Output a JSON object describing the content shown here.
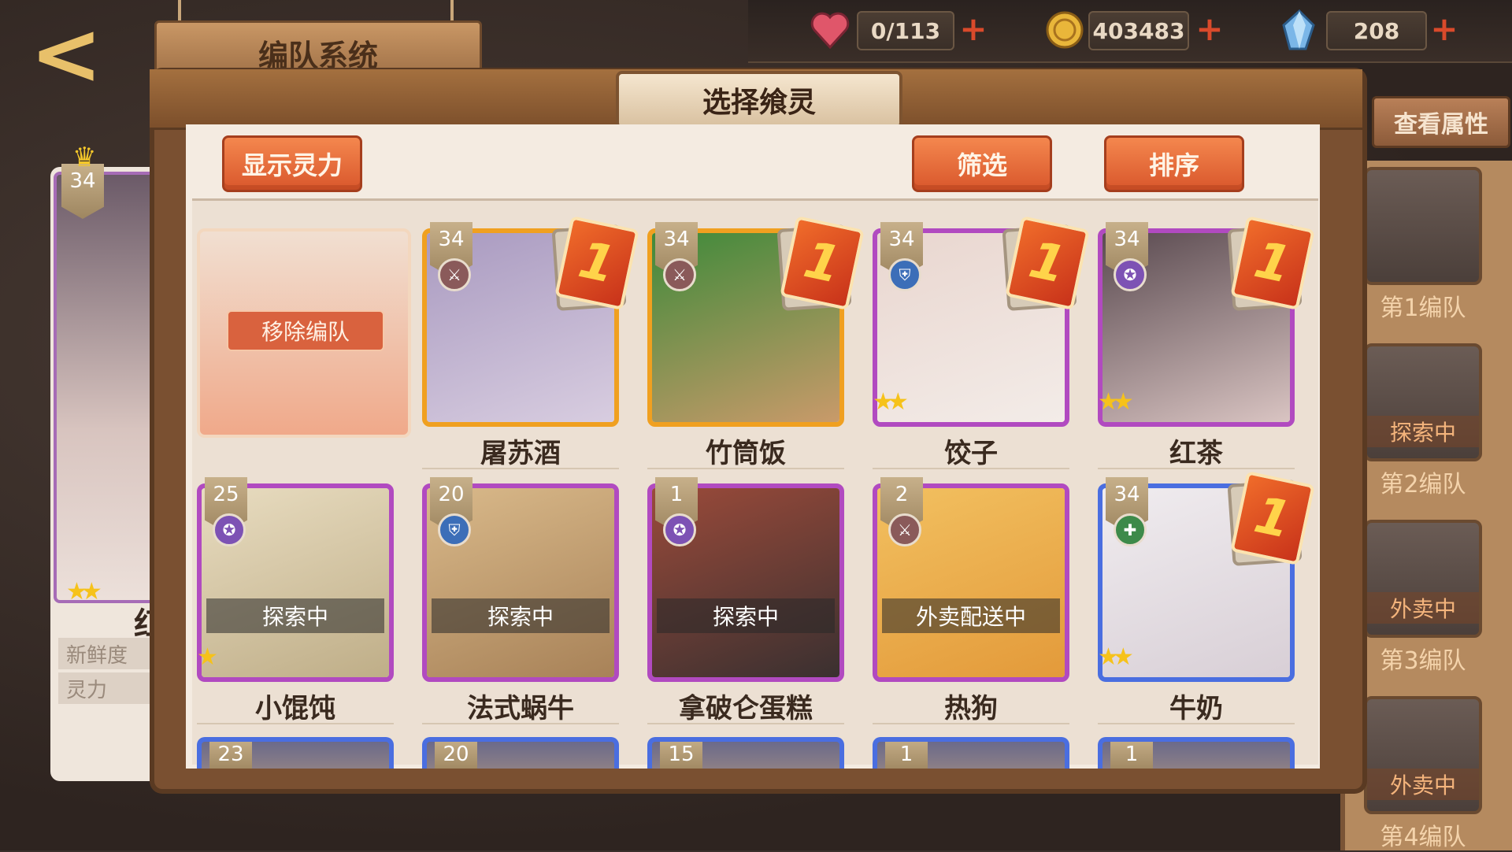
{
  "resources": {
    "stamina": "0/113",
    "coins": "403483",
    "gems": "208",
    "plus_label": "+"
  },
  "header": {
    "back_glyph": "<",
    "title": "编队系统"
  },
  "left_panel": {
    "level": "34",
    "name": "红茶",
    "freshness_label": "新鲜度",
    "power_label": "灵力"
  },
  "right_panel": {
    "view_attributes": "查看属性",
    "teams": [
      {
        "label": "第1编队",
        "status": ""
      },
      {
        "label": "第2编队",
        "status": "探索中"
      },
      {
        "label": "第3编队",
        "status": "外卖中"
      },
      {
        "label": "第4编队",
        "status": "外卖中"
      }
    ]
  },
  "modal": {
    "title": "选择飨灵",
    "show_power": "显示灵力",
    "filter": "筛选",
    "sort": "排序",
    "remove_from_team": "移除编队"
  },
  "cards": [
    {
      "name": "屠苏酒",
      "level": "34",
      "class": "sword",
      "rank": "1",
      "stars": 0,
      "status": "",
      "frame": "gold",
      "colors": [
        "#a99ac0",
        "#d8cde0"
      ]
    },
    {
      "name": "竹筒饭",
      "level": "34",
      "class": "sword",
      "rank": "1",
      "stars": 0,
      "status": "",
      "frame": "gold",
      "colors": [
        "#3f8a3a",
        "#c99a6a"
      ]
    },
    {
      "name": "饺子",
      "level": "34",
      "class": "shield",
      "rank": "1",
      "stars": 2,
      "status": "",
      "frame": "purple",
      "colors": [
        "#e9d6cf",
        "#f3ece8"
      ]
    },
    {
      "name": "红茶",
      "level": "34",
      "class": "star",
      "rank": "1",
      "stars": 2,
      "status": "",
      "frame": "purple",
      "colors": [
        "#5a4a50",
        "#d9c4c2"
      ]
    },
    {
      "name": "小馄饨",
      "level": "25",
      "class": "star",
      "rank": "",
      "stars": 1,
      "status": "探索中",
      "frame": "purple",
      "colors": [
        "#e8dcc0",
        "#bfae88"
      ]
    },
    {
      "name": "法式蜗牛",
      "level": "20",
      "class": "shield",
      "rank": "",
      "stars": 0,
      "status": "探索中",
      "frame": "purple",
      "colors": [
        "#d9b98a",
        "#a88258"
      ]
    },
    {
      "name": "拿破仑蛋糕",
      "level": "1",
      "class": "star",
      "rank": "",
      "stars": 0,
      "status": "探索中",
      "frame": "purple",
      "colors": [
        "#9a4a3a",
        "#3a3030"
      ]
    },
    {
      "name": "热狗",
      "level": "2",
      "class": "sword",
      "rank": "",
      "stars": 0,
      "status": "外卖配送中",
      "frame": "purple",
      "colors": [
        "#f2c060",
        "#e39a3a"
      ]
    },
    {
      "name": "牛奶",
      "level": "34",
      "class": "cross",
      "rank": "1",
      "stars": 2,
      "status": "",
      "frame": "blue",
      "colors": [
        "#f0ecef",
        "#d8cfd6"
      ]
    }
  ],
  "row3_levels": [
    "23",
    "20",
    "15",
    "1",
    "1"
  ],
  "badge_glyphs": {
    "sword": "⚔",
    "shield": "⛨",
    "star": "✪",
    "cross": "✚"
  },
  "icons": {
    "stamina": "heart-icon",
    "coins": "coin-icon",
    "gems": "crystal-icon"
  }
}
